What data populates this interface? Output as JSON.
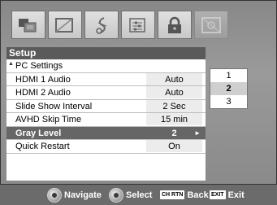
{
  "tabs": [
    {
      "icon": "picture-icon",
      "active": false
    },
    {
      "icon": "display-frame-icon",
      "active": false
    },
    {
      "icon": "music-note-icon",
      "active": false
    },
    {
      "icon": "equalizer-sliders-icon",
      "active": false
    },
    {
      "icon": "lock-icon",
      "active": false
    },
    {
      "icon": "setup-icon",
      "active": true
    }
  ],
  "menu": {
    "title": "Setup",
    "items": [
      {
        "label": "PC Settings",
        "value": ""
      },
      {
        "label": "HDMI 1 Audio",
        "value": "Auto"
      },
      {
        "label": "HDMI 2 Audio",
        "value": "Auto"
      },
      {
        "label": "Slide Show Interval",
        "value": "2 Sec"
      },
      {
        "label": "AVHD Skip Time",
        "value": "15 min"
      },
      {
        "label": "Gray Level",
        "value": "2",
        "selected": true
      },
      {
        "label": "Quick Restart",
        "value": "On"
      }
    ]
  },
  "options": {
    "items": [
      "1",
      "2",
      "3"
    ],
    "current": "2"
  },
  "navbar": {
    "navigate_label": "Navigate",
    "select_label": "Select",
    "back_key": "CH RTN",
    "back_label": "Back",
    "exit_key": "EXIT",
    "exit_label": "Exit"
  },
  "colors": {
    "frame": "#8f8f8f",
    "menu_header": "#5a5a5a",
    "selected_row": "#666666",
    "nav_bar": "#6b6b6b"
  }
}
